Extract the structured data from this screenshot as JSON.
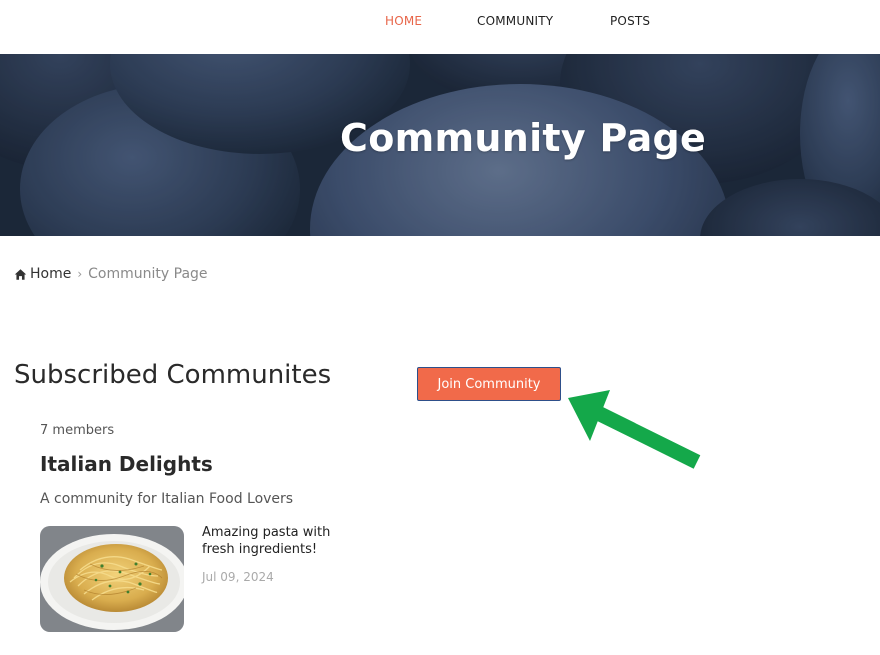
{
  "nav": {
    "items": [
      {
        "label": "HOME",
        "active": true
      },
      {
        "label": "COMMUNITY",
        "active": false
      },
      {
        "label": "POSTS",
        "active": false
      }
    ]
  },
  "hero": {
    "title": "Community Page"
  },
  "breadcrumb": {
    "home_label": "Home",
    "separator": "›",
    "current": "Community Page"
  },
  "section": {
    "heading": "Subscribed Communites",
    "join_button_label": "Join Community"
  },
  "community": {
    "members": "7 members",
    "name": "Italian Delights",
    "description": "A community for Italian Food Lovers",
    "post": {
      "title": "Amazing pasta with fresh ingredients!",
      "date": "Jul 09, 2024",
      "thumbnail_icon": "pasta-dish-image"
    }
  },
  "colors": {
    "accent": "#f16a4a",
    "nav_active": "#e8664a",
    "hero_bg": "#24334a",
    "annotation_arrow": "#14a84a"
  }
}
